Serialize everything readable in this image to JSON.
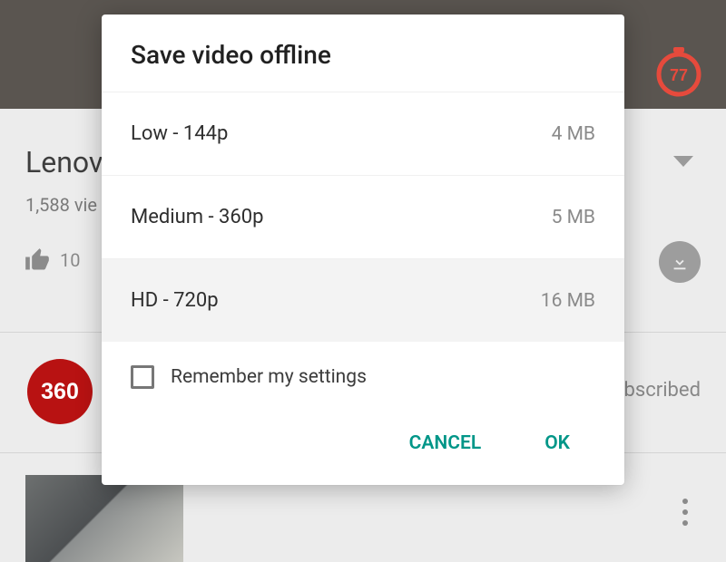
{
  "background": {
    "video_title_truncated": "Lenov",
    "views_text": "1,588 vie",
    "like_count": "10",
    "subscribed_text": "bscribed",
    "stopwatch_number": "77",
    "channel_badge_text": "360"
  },
  "dialog": {
    "title": "Save video offline",
    "options": [
      {
        "label": "Low - 144p",
        "size": "4 MB",
        "selected": false
      },
      {
        "label": "Medium - 360p",
        "size": "5 MB",
        "selected": false
      },
      {
        "label": "HD - 720p",
        "size": "16 MB",
        "selected": true
      }
    ],
    "remember_label": "Remember my settings",
    "remember_checked": false,
    "cancel_label": "Cancel",
    "ok_label": "OK",
    "accent_color": "#009688"
  }
}
